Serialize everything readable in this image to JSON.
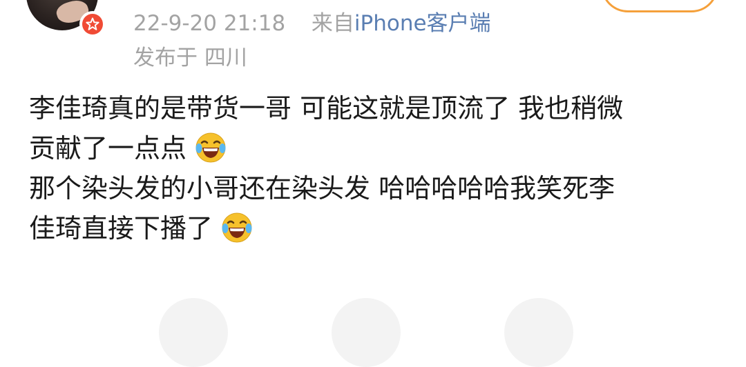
{
  "post_header": {
    "timestamp": "22-9-20 21:18",
    "source_prefix": "来自",
    "source_device": "iPhone客户端",
    "location": "发布于 四川"
  },
  "post": {
    "lines": [
      "李佳琦真的是带货一哥 可能这就是顶流了 我也稍微",
      "贡献了一点点",
      "那个染头发的小哥还在染头发 哈哈哈哈哈我笑死李",
      "佳琦直接下播了"
    ],
    "emoji_name": "laugh-cry-icon"
  },
  "colors": {
    "meta_text": "#a3a3a3",
    "source_link": "#5a7eb2",
    "body_text": "#1a1a1a",
    "verified_badge": "#f04b35",
    "follow_border": "#f5a03a",
    "emoji_face": "#f6c12b"
  },
  "icons": {
    "avatar": "avatar",
    "verified": "verified-badge-icon",
    "follow": "follow-button"
  }
}
